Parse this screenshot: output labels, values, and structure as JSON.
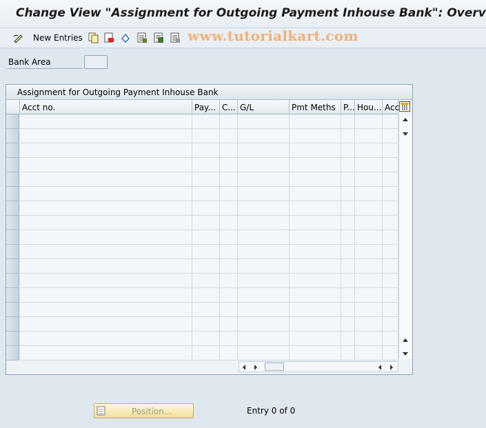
{
  "window": {
    "title": "Change View \"Assignment for Outgoing Payment Inhouse Bank\": Overview"
  },
  "toolbar": {
    "new_entries_label": "New Entries",
    "icons": [
      "edit-pen-icon",
      "copy-icon",
      "delete-icon",
      "undo-icon",
      "select-all-icon",
      "select-block-icon",
      "deselect-all-icon"
    ]
  },
  "watermark": "www.tutorialkart.com",
  "filter": {
    "bank_area_label": "Bank Area",
    "bank_area_value": ""
  },
  "table": {
    "title": "Assignment for Outgoing Payment Inhouse Bank",
    "columns": [
      "Acct no.",
      "Pay...",
      "C...",
      "G/L",
      "Pmt Meths",
      "P...",
      "Hou...",
      "Acc"
    ],
    "row_count": 17,
    "rows": []
  },
  "footer": {
    "position_label": "Position...",
    "entry_text": "Entry 0 of 0"
  },
  "colors": {
    "background": "#dfe7ef",
    "watermark": "#f0b27a",
    "position_button": "#efdf9c"
  }
}
